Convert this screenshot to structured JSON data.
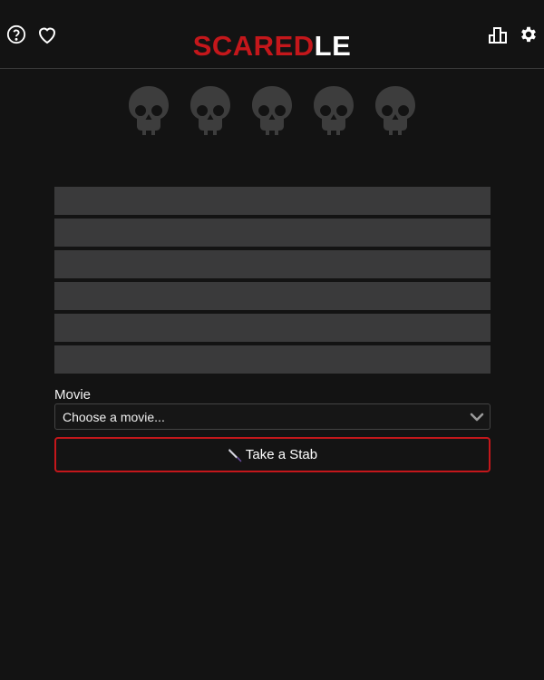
{
  "header": {
    "logo_primary": "SCARED",
    "logo_secondary": "LE",
    "help_icon": "help-circle-icon",
    "favorite_icon": "heart-icon",
    "stats_icon": "bar-chart-icon",
    "settings_icon": "gear-icon"
  },
  "lives": {
    "total": 5,
    "remaining": 5,
    "icon": "skull-icon"
  },
  "guess_rows": {
    "count": 6
  },
  "form": {
    "movie_label": "Movie",
    "movie_select_value": "Choose a movie...",
    "submit_label": "Take a Stab",
    "submit_icon": "knife-icon"
  },
  "colors": {
    "background": "#131313",
    "accent_red": "#c4171b",
    "row_fill": "#3a3a3b",
    "skull": "#3d3d3d"
  }
}
